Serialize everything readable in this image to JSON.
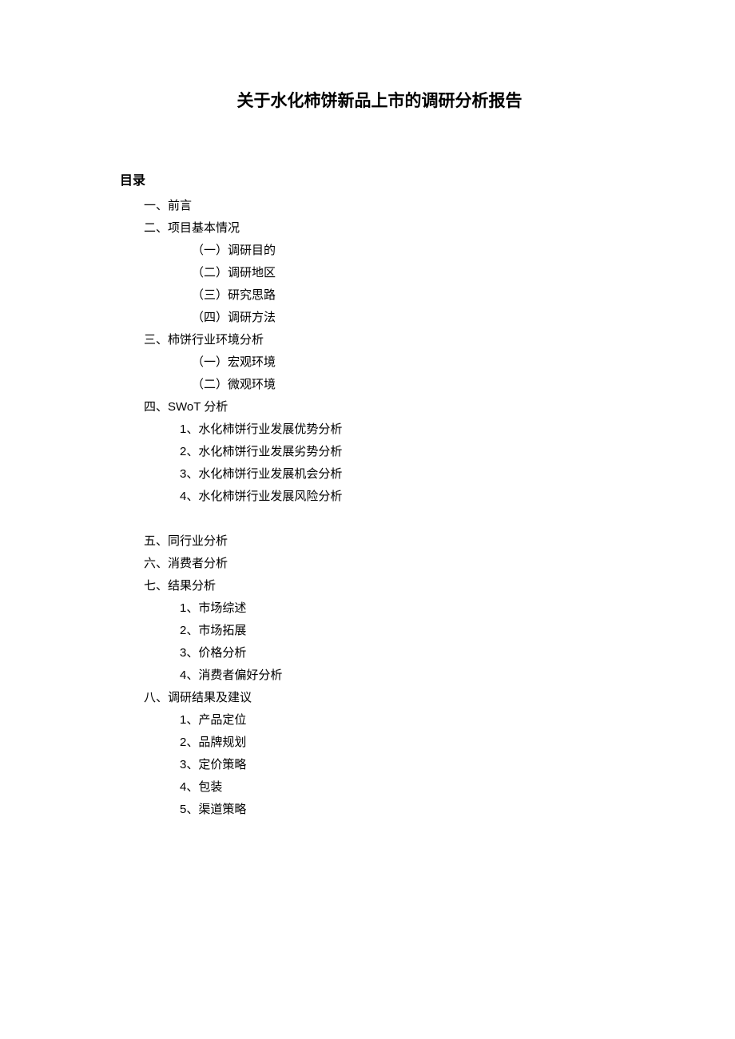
{
  "title": "关于水化柿饼新品上市的调研分析报告",
  "toc_label": "目录",
  "sections": {
    "s1": "一、前言",
    "s2": {
      "title": "二、项目基本情况",
      "items": {
        "i1": "（一）调研目的",
        "i2": "（二）调研地区",
        "i3": "（三）研究思路",
        "i4": "（四）调研方法"
      }
    },
    "s3": {
      "title": "三、柿饼行业环境分析",
      "items": {
        "i1": "（一）宏观环境",
        "i2": "（二）微观环境"
      }
    },
    "s4": {
      "title": "四、SWoT 分析",
      "items": {
        "i1": "1、水化柿饼行业发展优势分析",
        "i2": "2、水化柿饼行业发展劣势分析",
        "i3": "3、水化柿饼行业发展机会分析",
        "i4": "4、水化柿饼行业发展风险分析"
      }
    },
    "s5": "五、同行业分析",
    "s6": "六、消费者分析",
    "s7": {
      "title": "七、结果分析",
      "items": {
        "i1": "1、市场综述",
        "i2": "2、市场拓展",
        "i3": "3、价格分析",
        "i4": "4、消费者偏好分析"
      }
    },
    "s8": {
      "title": "八、调研结果及建议",
      "items": {
        "i1": "1、产品定位",
        "i2": "2、品牌规划",
        "i3": "3、定价策略",
        "i4": "4、包装",
        "i5": "5、渠道策略"
      }
    }
  }
}
